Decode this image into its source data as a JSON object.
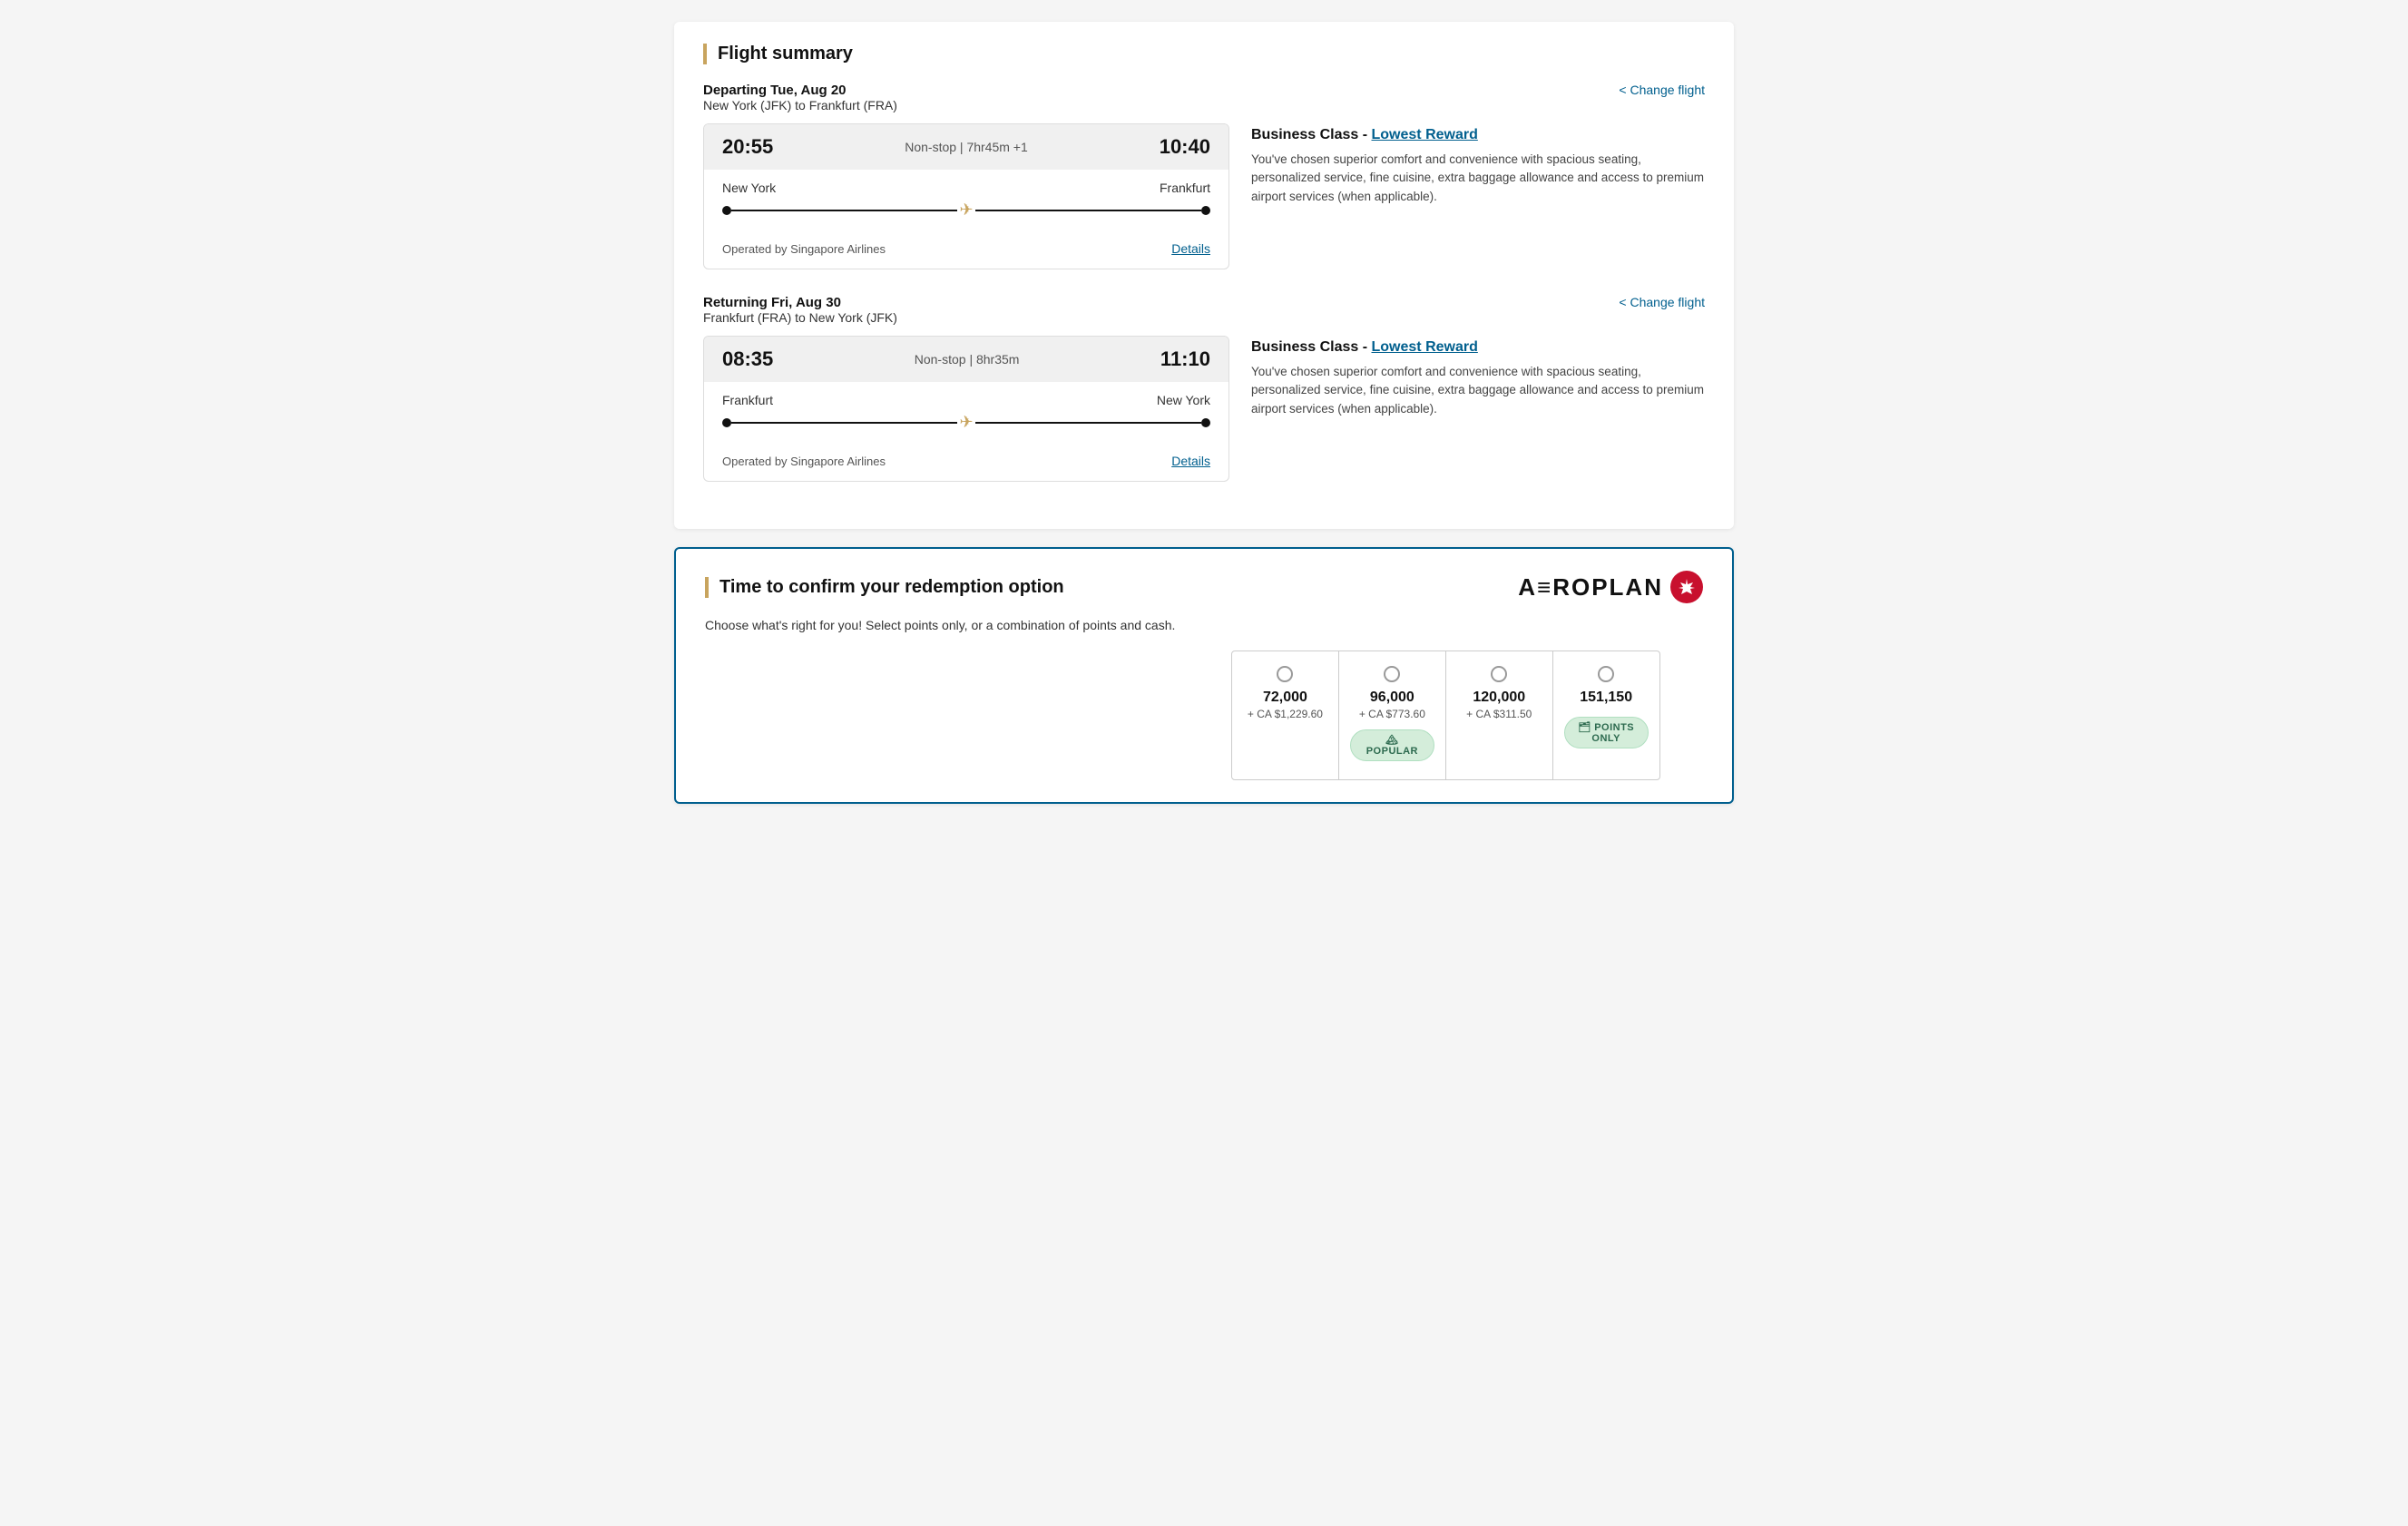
{
  "flightSummary": {
    "title": "Flight summary",
    "outbound": {
      "label": "Departing Tue, Aug 20",
      "route": "New York (JFK) to Frankfurt (FRA)",
      "changeFlight": "< Change flight",
      "departure": "20:55",
      "arrival": "10:40",
      "duration": "Non-stop | 7hr45m +1",
      "fromCity": "New York",
      "toCity": "Frankfurt",
      "operator": "Operated by Singapore Airlines",
      "detailsLabel": "Details",
      "cabinTitle": "Business Class - ",
      "cabinLink": "Lowest Reward",
      "cabinDesc": "You've chosen superior comfort and convenience with spacious seating, personalized service, fine cuisine, extra baggage allowance and access to premium airport services (when applicable)."
    },
    "return": {
      "label": "Returning Fri, Aug 30",
      "route": "Frankfurt (FRA) to New York (JFK)",
      "changeFlight": "< Change flight",
      "departure": "08:35",
      "arrival": "11:10",
      "duration": "Non-stop | 8hr35m",
      "fromCity": "Frankfurt",
      "toCity": "New York",
      "operator": "Operated by Singapore Airlines",
      "detailsLabel": "Details",
      "cabinTitle": "Business Class - ",
      "cabinLink": "Lowest Reward",
      "cabinDesc": "You've chosen superior comfort and convenience with spacious seating, personalized service, fine cuisine, extra baggage allowance and access to premium airport services (when applicable)."
    }
  },
  "redemption": {
    "title": "Time to confirm your redemption option",
    "subtitle": "Choose what's right for you! Select points only, or a combination of points and cash.",
    "aeroplanText": "A≡ROPLAN",
    "options": [
      {
        "points": "72,000",
        "cash": "+ CA $1,229.60",
        "badge": null
      },
      {
        "points": "96,000",
        "cash": "+ CA $773.60",
        "badge": "POPULAR",
        "badgeType": "popular"
      },
      {
        "points": "120,000",
        "cash": "+ CA $311.50",
        "badge": null
      },
      {
        "points": "151,150",
        "cash": "",
        "badge": "POINTS ONLY",
        "badgeType": "points-only"
      }
    ]
  }
}
